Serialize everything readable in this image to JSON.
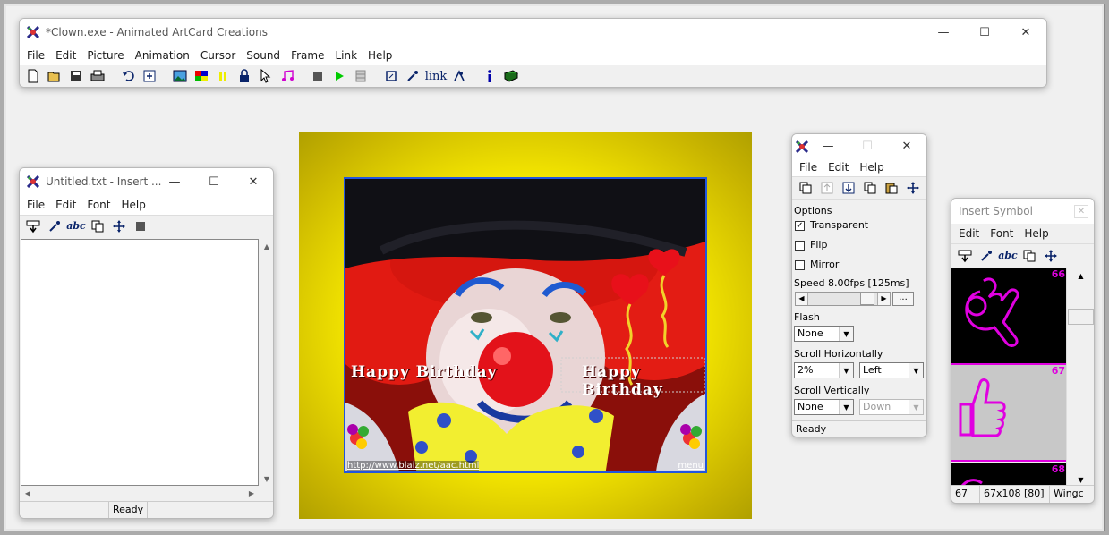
{
  "main": {
    "title": "*Clown.exe - Animated ArtCard Creations",
    "menu": [
      "File",
      "Edit",
      "Picture",
      "Animation",
      "Cursor",
      "Sound",
      "Frame",
      "Link",
      "Help"
    ],
    "toolbar": [
      "new-icon",
      "open-icon",
      "save-icon",
      "print-icon",
      "undo-icon",
      "add-frame-icon",
      "picture-icon",
      "palette-icon",
      "pause-icon",
      "lock-icon",
      "cursor-icon",
      "music-icon",
      "stop-icon",
      "play-icon",
      "frames-icon",
      "crop-icon",
      "eyedropper-icon",
      "link-icon",
      "tool-icon",
      "info-icon",
      "book-icon"
    ],
    "link_label": "link"
  },
  "card": {
    "greeting_left": "Happy Birthday",
    "greeting_right": "Happy Birthday",
    "url": "http://www.blaiz.net/aac.html",
    "menu_link": "menu"
  },
  "text_window": {
    "title": "Untitled.txt - Insert ...",
    "menu": [
      "File",
      "Edit",
      "Font",
      "Help"
    ],
    "status": "Ready"
  },
  "options_window": {
    "menu": [
      "File",
      "Edit",
      "Help"
    ],
    "options_label": "Options",
    "transparent": "Transparent",
    "flip": "Flip",
    "mirror": "Mirror",
    "speed_label": "Speed 8.00fps [125ms]",
    "speed_button": "...",
    "flash_label": "Flash",
    "flash_value": "None",
    "scroll_h_label": "Scroll Horizontally",
    "scroll_h_value": "2%",
    "scroll_h_dir": "Left",
    "scroll_v_label": "Scroll Vertically",
    "scroll_v_value": "None",
    "scroll_v_dir": "Down",
    "status": "Ready"
  },
  "symbol_window": {
    "title": "Insert Symbol",
    "menu": [
      "Edit",
      "Font",
      "Help"
    ],
    "symbols": [
      {
        "num": "66"
      },
      {
        "num": "67"
      },
      {
        "num": "68"
      }
    ],
    "status": [
      "67",
      "67x108 [80]",
      "Wingc"
    ]
  },
  "colors": {
    "accent": "#0a246a",
    "magenta": "#e000e0",
    "card_yellow": "#f0e000"
  }
}
